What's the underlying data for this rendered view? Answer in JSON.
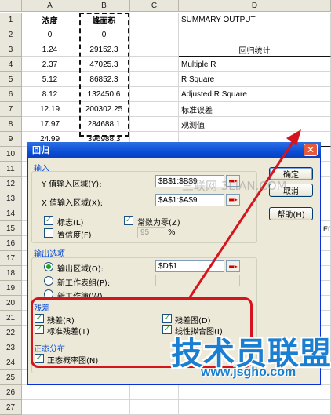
{
  "sheet": {
    "columns": [
      "A",
      "B",
      "C",
      "D"
    ],
    "rows": [
      "1",
      "2",
      "3",
      "4",
      "5",
      "6",
      "7",
      "8",
      "9",
      "10",
      "11",
      "12",
      "13",
      "14",
      "15",
      "16",
      "17",
      "18",
      "19",
      "20",
      "21",
      "22",
      "23",
      "24",
      "25",
      "26",
      "27"
    ],
    "colA": [
      "浓度",
      "0",
      "1.24",
      "2.37",
      "5.12",
      "8.12",
      "12.19",
      "17.97",
      "24.99"
    ],
    "colB": [
      "峰面积",
      "0",
      "29152.3",
      "47025.3",
      "86852.3",
      "132450.6",
      "200302.25",
      "284688.1",
      "396988.3"
    ],
    "colD": [
      "SUMMARY OUTPUT",
      "",
      "",
      "Multiple R",
      "R Square",
      "Adjusted R Square",
      "标准误差",
      "观测值"
    ],
    "d3": "回归统计",
    "right_fragments": {
      "r11": "",
      "r16": "Eff"
    }
  },
  "dialog": {
    "title": "回归",
    "close_glyph": "✕",
    "input_section": "输入",
    "y_label": "Y 值输入区域(Y):",
    "y_value": "$B$1:$B$9",
    "x_label": "X 值输入区域(X):",
    "x_value": "$A$1:$A$9",
    "chk_labels": "标志(L)",
    "chk_const": "常数为零(Z)",
    "chk_conf": "置信度(F)",
    "conf_value": "95",
    "conf_unit": "%",
    "output_section": "输出选项",
    "radio_output": "输出区域(O):",
    "output_value": "$D$1",
    "radio_new_sheet": "新工作表组(P):",
    "radio_new_book": "新工作簿(W)",
    "residual_section": "残差",
    "chk_residual": "残差(R)",
    "chk_std_residual": "标准残差(T)",
    "chk_residual_plot": "残差图(D)",
    "chk_line_fit": "线性拟合图(I)",
    "normal_section": "正态分布",
    "chk_normal_prob": "正态概率图(N)",
    "btn_ok": "确定",
    "btn_cancel": "取消",
    "btn_help": "帮助(H)",
    "picker_glyph": "▬▸",
    "check_glyph": "✓"
  },
  "watermarks": {
    "faint": "三联网 3LIAN.COM",
    "brand": "技术员联盟",
    "url": "www.jsgho.com"
  },
  "colors": {
    "title_bar": "#0a4fd6",
    "dialog_bg": "#ece9d8",
    "highlight": "#d6141d",
    "brand": "#1a7fd0"
  }
}
